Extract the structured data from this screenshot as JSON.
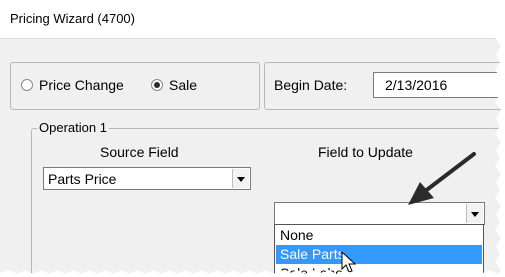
{
  "window": {
    "title": "Pricing Wizard (4700)"
  },
  "options": {
    "price_change_label": "Price Change",
    "sale_label": "Sale",
    "selected": "Sale"
  },
  "begin_date": {
    "label": "Begin Date:",
    "value": "2/13/2016"
  },
  "operation": {
    "legend": "Operation 1",
    "source_field_label": "Source Field",
    "source_field_value": "Parts Price",
    "field_to_update_label": "Field to Update",
    "field_to_update_value": "",
    "dropdown_options": [
      "None",
      "Sale Parts",
      "Sale Labor"
    ],
    "highlighted_option": "Sale Parts"
  },
  "colors": {
    "highlight": "#3399ff",
    "arrow": "#2b2b2b"
  },
  "icons": [
    "chevron-down-icon",
    "annotation-arrow",
    "mouse-cursor-icon",
    "radio-button"
  ]
}
